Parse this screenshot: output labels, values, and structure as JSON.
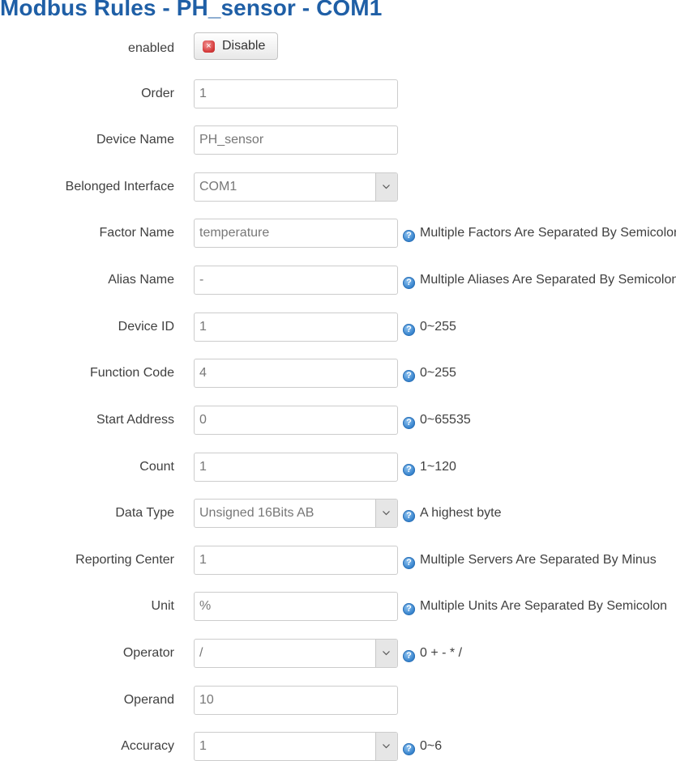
{
  "page": {
    "title": "Modbus Rules - PH_sensor - COM1"
  },
  "enabled": {
    "label": "enabled",
    "button_label": "Disable",
    "button_icon": "close-icon"
  },
  "fields": {
    "order": {
      "label": "Order",
      "value": "1"
    },
    "device_name": {
      "label": "Device Name",
      "value": "PH_sensor"
    },
    "belonged_interface": {
      "label": "Belonged Interface",
      "selected": "COM1"
    },
    "factor_name": {
      "label": "Factor Name",
      "value": "temperature",
      "hint": "Multiple Factors Are Separated By Semicolon"
    },
    "alias_name": {
      "label": "Alias Name",
      "value": "-",
      "hint": "Multiple Aliases Are Separated By Semicolon"
    },
    "device_id": {
      "label": "Device ID",
      "value": "1",
      "hint": "0~255"
    },
    "function_code": {
      "label": "Function Code",
      "value": "4",
      "hint": "0~255"
    },
    "start_address": {
      "label": "Start Address",
      "value": "0",
      "hint": "0~65535"
    },
    "count": {
      "label": "Count",
      "value": "1",
      "hint": "1~120"
    },
    "data_type": {
      "label": "Data Type",
      "selected": "Unsigned 16Bits AB",
      "hint": "A highest byte"
    },
    "reporting_center": {
      "label": "Reporting Center",
      "value": "1",
      "hint": "Multiple Servers Are Separated By Minus"
    },
    "unit": {
      "label": "Unit",
      "value": "%",
      "hint": "Multiple Units Are Separated By Semicolon"
    },
    "operator": {
      "label": "Operator",
      "selected": "/",
      "hint": "0 + - * /"
    },
    "operand": {
      "label": "Operand",
      "value": "10"
    },
    "accuracy": {
      "label": "Accuracy",
      "selected": "1",
      "hint": "0~6"
    }
  },
  "icons": {
    "help": "?",
    "close": "×"
  }
}
